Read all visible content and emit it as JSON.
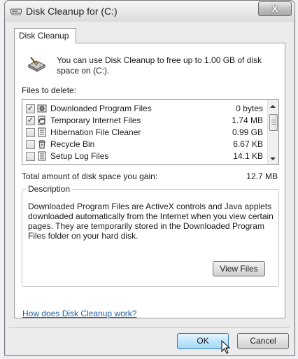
{
  "window": {
    "title": "Disk Cleanup for  (C:)",
    "close_label": "X"
  },
  "tab": {
    "label": "Disk Cleanup"
  },
  "intro": {
    "text": "You can use Disk Cleanup to free up to 1.00 GB of disk space on  (C:)."
  },
  "files": {
    "label": "Files to delete:",
    "items": [
      {
        "checked": true,
        "icon": "downloaded-files-icon",
        "name": "Downloaded Program Files",
        "size": "0 bytes"
      },
      {
        "checked": true,
        "icon": "internet-files-icon",
        "name": "Temporary Internet Files",
        "size": "1.74 MB"
      },
      {
        "checked": false,
        "icon": "document-icon",
        "name": "Hibernation File Cleaner",
        "size": "0.99 GB"
      },
      {
        "checked": false,
        "icon": "recycle-bin-icon",
        "name": "Recycle Bin",
        "size": "6.67 KB"
      },
      {
        "checked": false,
        "icon": "document-icon",
        "name": "Setup Log Files",
        "size": "14.1 KB"
      }
    ]
  },
  "total": {
    "label": "Total amount of disk space you gain:",
    "value": "12.7 MB"
  },
  "description": {
    "legend": "Description",
    "text": "Downloaded Program Files are ActiveX controls and Java applets downloaded automatically from the Internet when you view certain pages. They are temporarily stored in the Downloaded Program Files folder on your hard disk.",
    "view_files_label": "View Files"
  },
  "help_link": "How does Disk Cleanup work?",
  "buttons": {
    "ok": "OK",
    "cancel": "Cancel"
  }
}
